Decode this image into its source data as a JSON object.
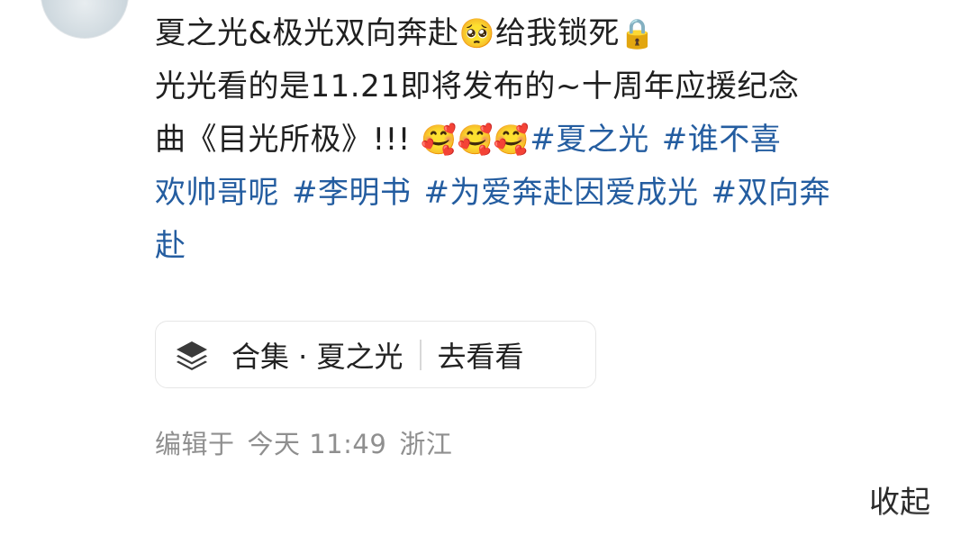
{
  "post": {
    "line1": "夏之光&极光双向奔赴",
    "emoji_pleading": "🥺",
    "line1_end": "给我锁死",
    "emoji_lock": "🔒",
    "line2": "光光看的是11.21即将发布的~十周年应援纪念",
    "line3_text": "曲《目光所极》!!! ",
    "emoji_smiling_hearts": "🥰🥰🥰",
    "hashtags": [
      "#夏之光",
      "#谁不喜欢帅哥呢",
      "#李明书",
      "#为爱奔赴因爱成光",
      "#双向奔赴"
    ]
  },
  "tag_parts": {
    "t1": "#夏之光",
    "t2a": "#谁不喜",
    "t2b": "欢帅哥呢",
    "t3": "#李明书",
    "t4": "#为爱奔赴因爱成光",
    "t5a": "#双向奔",
    "t5b": "赴"
  },
  "collection": {
    "icon": "layers-icon",
    "label": "合集 · 夏之光",
    "action": "去看看"
  },
  "meta": {
    "edited": "编辑于",
    "time": "今天 11:49",
    "location": "浙江"
  },
  "collapse_label": "收起",
  "colors": {
    "hashtag": "#245da0",
    "meta_text": "#8f8f8f",
    "card_border": "#e6e6e6"
  }
}
